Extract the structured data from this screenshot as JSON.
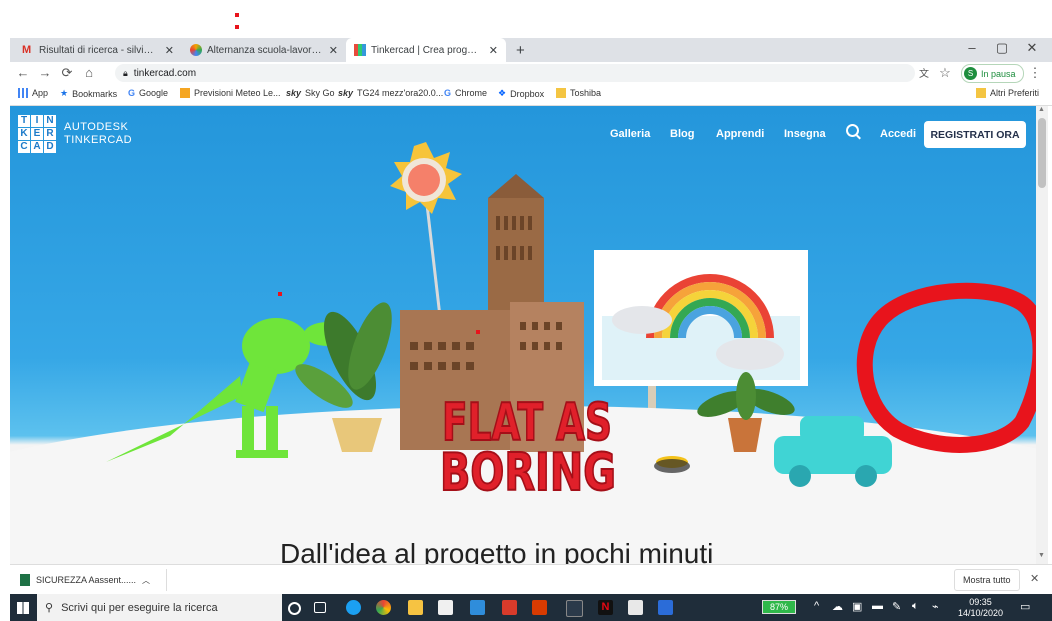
{
  "tabs": [
    {
      "title": "Risultati di ricerca - silvia.galasso@",
      "color": "#d93025"
    },
    {
      "title": "Alternanza scuola-lavoro: formaz",
      "color": "#f2a400"
    },
    {
      "title": "Tinkercad | Crea progetti digitali",
      "color": "#3e9ee0"
    }
  ],
  "new_tab": "+",
  "address": {
    "url": "tinkercad.com",
    "profile_initial": "S",
    "profile_status": "In pausa"
  },
  "bookmarks": [
    {
      "label": "App",
      "color": "#4285f4"
    },
    {
      "label": "Bookmarks",
      "color": "#1a73e8"
    },
    {
      "label": "Google",
      "color": "#4285f4"
    },
    {
      "label": "Previsioni Meteo Le...",
      "color": "#f5a623"
    },
    {
      "label": "Sky Go",
      "color": "#222"
    },
    {
      "label": "TG24 mezz'ora20.0...",
      "color": "#222"
    },
    {
      "label": "Chrome",
      "color": "#4285f4"
    },
    {
      "label": "Dropbox",
      "color": "#0061ff"
    },
    {
      "label": "Toshiba",
      "color": "#f4c542"
    }
  ],
  "other_bookmarks": "Altri Preferiti",
  "site": {
    "logo_letters": [
      "T",
      "I",
      "N",
      "K",
      "E",
      "R",
      "C",
      "A",
      "D"
    ],
    "brand_line1": "AUTODESK",
    "brand_line2": "TINKERCAD",
    "nav": [
      "Galleria",
      "Blog",
      "Apprendi",
      "Insegna",
      "Accedi"
    ],
    "cta": "REGISTRATI ORA",
    "sign_line1": "FLAT AS",
    "sign_line2": "BORING",
    "headline": "Dall'idea al progetto in pochi minuti"
  },
  "download": {
    "filename": "SICUREZZA Aassent......",
    "show_all": "Mostra tutto"
  },
  "taskbar": {
    "search_placeholder": "Scrivi qui per eseguire la ricerca",
    "battery": "87%",
    "time": "09:35",
    "date": "14/10/2020"
  },
  "colors": {
    "hero_blue": "#2496db",
    "cta_text": "#24304a",
    "annotation_red": "#e8141c",
    "taskbar": "#1f2d3a"
  }
}
